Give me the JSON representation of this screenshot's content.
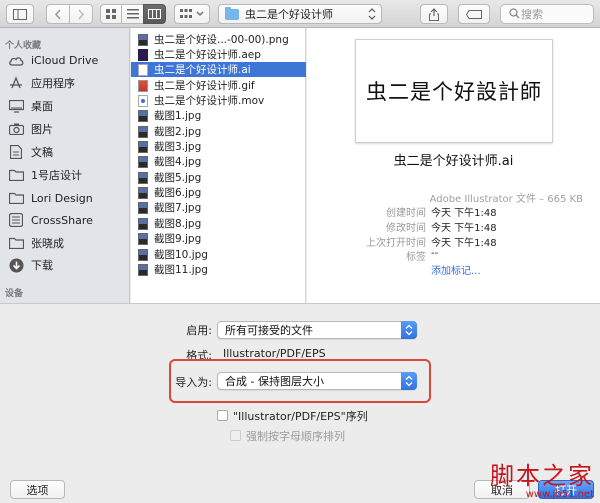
{
  "toolbar": {
    "path_title": "虫二是个好设计师",
    "search_placeholder": "搜索"
  },
  "sidebar": {
    "favorites_header": "个人收藏",
    "devices_header": "设备",
    "items": [
      {
        "label": "iCloud Drive",
        "icon": "cloud-icon"
      },
      {
        "label": "应用程序",
        "icon": "applications-icon"
      },
      {
        "label": "桌面",
        "icon": "desktop-icon"
      },
      {
        "label": "图片",
        "icon": "camera-icon"
      },
      {
        "label": "文稿",
        "icon": "documents-icon"
      },
      {
        "label": "1号店设计",
        "icon": "folder-icon"
      },
      {
        "label": "Lori Design",
        "icon": "folder-icon"
      },
      {
        "label": "CrossShare",
        "icon": "folder-icon"
      },
      {
        "label": "张晓成",
        "icon": "folder-icon"
      },
      {
        "label": "下载",
        "icon": "download-icon"
      }
    ]
  },
  "files": [
    {
      "name": "虫二是个好设...-00-00).png",
      "type": "img"
    },
    {
      "name": "虫二是个好设计师.aep",
      "type": "aep"
    },
    {
      "name": "虫二是个好设计师.ai",
      "type": "ai",
      "selected": true
    },
    {
      "name": "虫二是个好设计师.gif",
      "type": "gif"
    },
    {
      "name": "虫二是个好设计师.mov",
      "type": "mov"
    },
    {
      "name": "截图1.jpg",
      "type": "img"
    },
    {
      "name": "截图2.jpg",
      "type": "img"
    },
    {
      "name": "截图3.jpg",
      "type": "img"
    },
    {
      "name": "截图4.jpg",
      "type": "img"
    },
    {
      "name": "截图5.jpg",
      "type": "img"
    },
    {
      "name": "截图6.jpg",
      "type": "img"
    },
    {
      "name": "截图7.jpg",
      "type": "img"
    },
    {
      "name": "截图8.jpg",
      "type": "img"
    },
    {
      "name": "截图9.jpg",
      "type": "img"
    },
    {
      "name": "截图10.jpg",
      "type": "img"
    },
    {
      "name": "截图11.jpg",
      "type": "img"
    }
  ],
  "preview": {
    "thumbnail_text": "虫二是个好設計師",
    "filename": "虫二是个好设计师.ai",
    "kind": "Adobe Illustrator 文件 – 665 KB",
    "meta": [
      {
        "key": "创建时间",
        "value": "今天 下午1:48"
      },
      {
        "key": "修改时间",
        "value": "今天 下午1:48"
      },
      {
        "key": "上次打开时间",
        "value": "今天 下午1:48"
      },
      {
        "key": "标签",
        "value": "--"
      },
      {
        "key": "",
        "value": "添加标记...",
        "link": true
      }
    ]
  },
  "options": {
    "enable_label": "启用:",
    "enable_value": "所有可接受的文件",
    "format_label": "格式:",
    "format_value": "Illustrator/PDF/EPS",
    "import_as_label": "导入为:",
    "import_as_value": "合成 - 保持图层大小",
    "checkbox1_label": "\"Illustrator/PDF/EPS\"序列",
    "checkbox2_label": "强制按字母顺序排列"
  },
  "buttons": {
    "options": "选项",
    "cancel": "取消",
    "open": "打开"
  },
  "watermark": {
    "main": "脚本之家",
    "sub": "www.jb51.net"
  }
}
